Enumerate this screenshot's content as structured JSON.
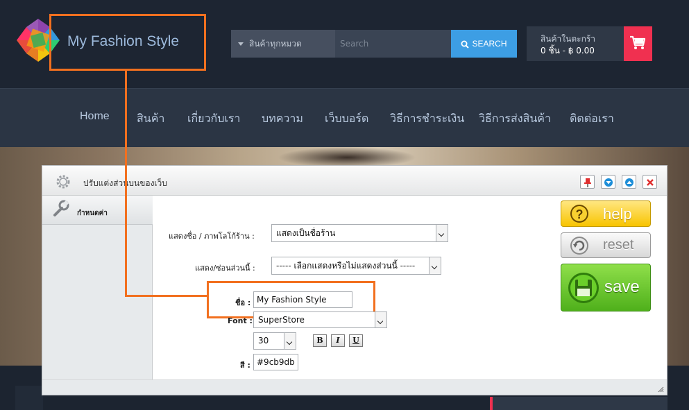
{
  "site": {
    "name": "My Fashion Style",
    "name_color": "#9cb9db"
  },
  "search": {
    "category_label": "สินค้าทุกหมวด",
    "placeholder": "Search",
    "button_label": "SEARCH"
  },
  "cart": {
    "title": "สินค้าในตะกร้า",
    "summary": "0 ชิ้น - ฿ 0.00"
  },
  "nav": {
    "items": [
      {
        "label": "Home"
      },
      {
        "label": "สินค้า"
      },
      {
        "label": "เกี่ยวกับเรา"
      },
      {
        "label": "บทความ"
      },
      {
        "label": "เว็บบอร์ด"
      },
      {
        "label": "วิธีการชำระเงิน"
      },
      {
        "label": "วิธีการส่งสินค้า"
      },
      {
        "label": "ติดต่อเรา"
      }
    ]
  },
  "panel": {
    "title": "ปรับแต่งส่วนบนของเว็บ",
    "sidebar_tab": "กำหนดค่า",
    "form": {
      "logo_label": "แสดงชื่อ / ภาพโลโก้ร้าน :",
      "logo_value": "แสดงเป็นชื่อร้าน",
      "toggle_label": "แสดง/ซ่อนส่วนนี้ :",
      "toggle_value": "----- เลือกแสดงหรือไม่แสดงส่วนนี้ -----",
      "name_label": "ชื่อ :",
      "name_value": "My Fashion Style",
      "font_label": "Font :",
      "font_value": "SuperStore",
      "size_value": "30",
      "bold_label": "B",
      "italic_label": "I",
      "underline_label": "U",
      "color_label": "สี :",
      "color_value": "#9cb9db"
    },
    "buttons": {
      "help": "help",
      "reset": "reset",
      "save": "save"
    }
  },
  "colors": {
    "accent": "#f2701f",
    "search_button": "#3d9ee4",
    "cart_button": "#f03050",
    "save_green": "#5cbf22",
    "help_yellow": "#f8c400"
  }
}
